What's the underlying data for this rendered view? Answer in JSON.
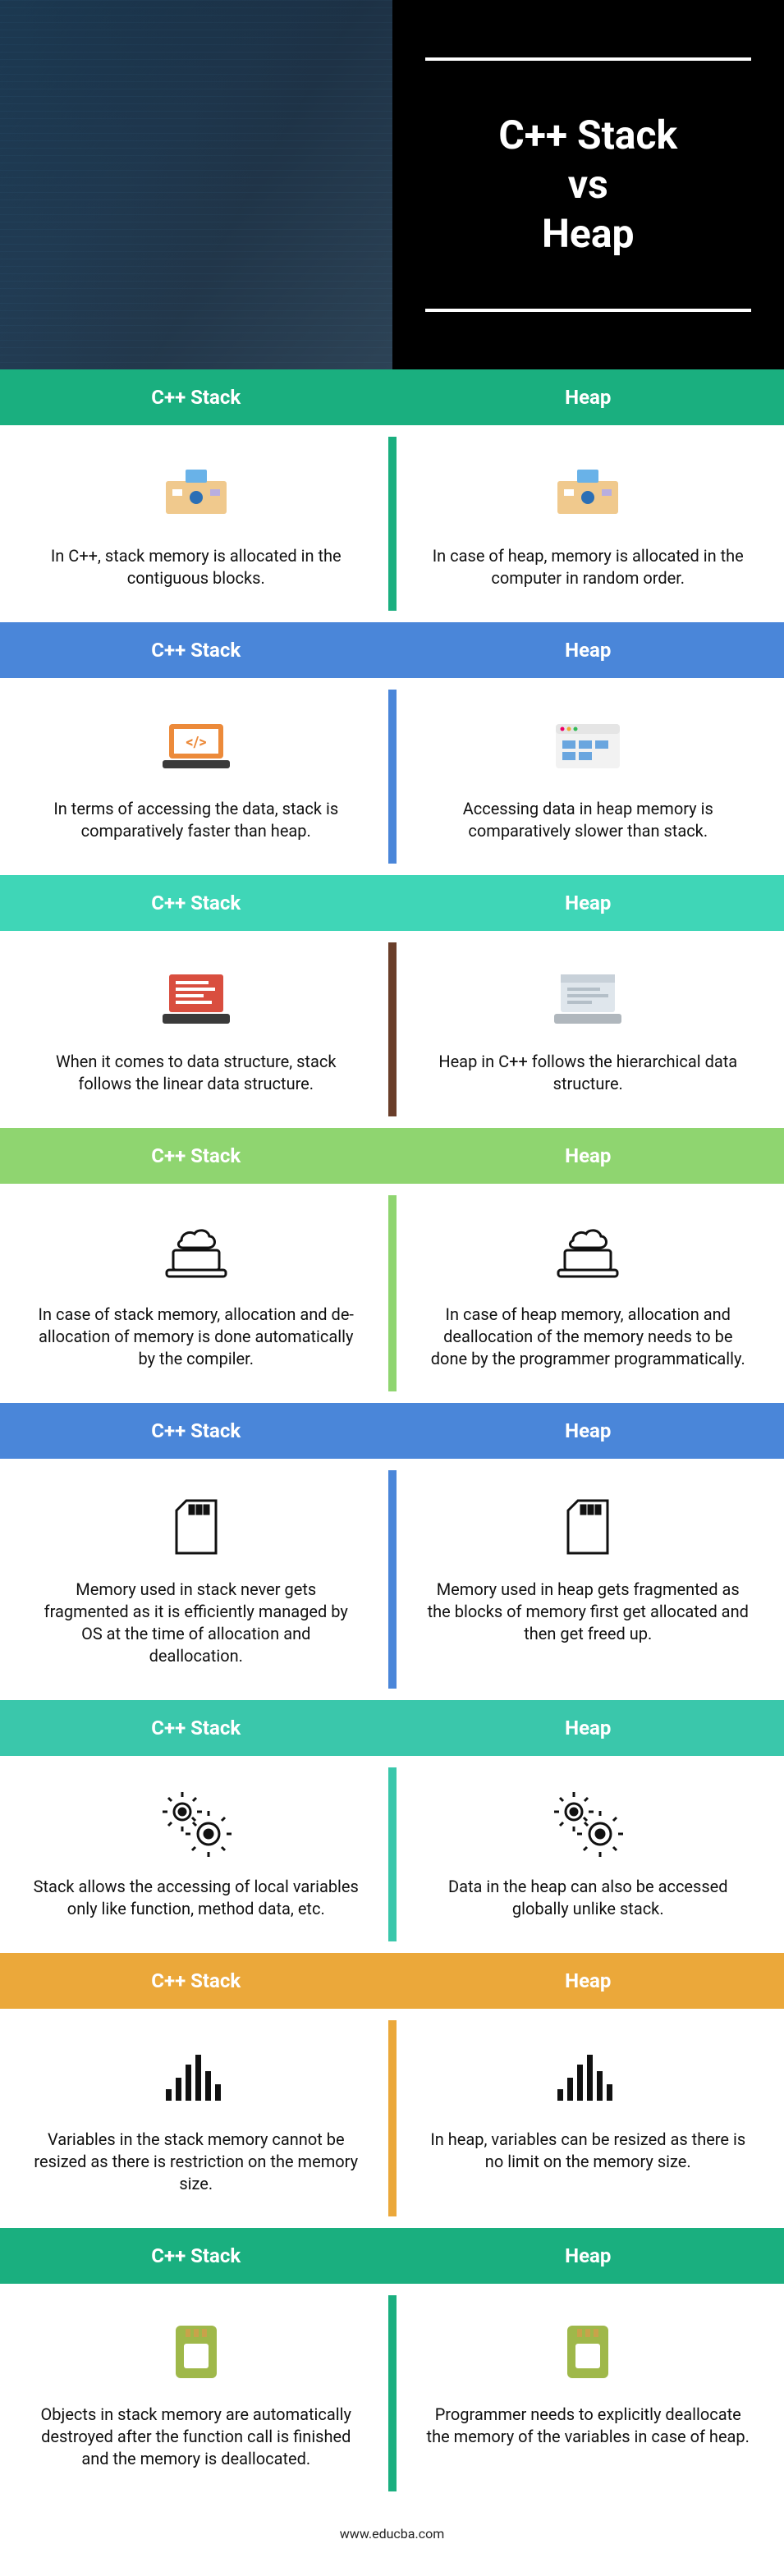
{
  "title_line1": "C++ Stack",
  "title_line2": "vs",
  "title_line3": "Heap",
  "sections": [
    {
      "left_header": "C++ Stack",
      "right_header": "Heap",
      "left_text": "In C++, stack memory is allocated in the contiguous blocks.",
      "right_text": "In case of heap, memory is allocated in the computer in random order.",
      "header_bg": "#1aaf7f",
      "divider_color": "#1aaf7f"
    },
    {
      "left_header": "C++ Stack",
      "right_header": "Heap",
      "left_text": "In terms of accessing the data, stack is comparatively faster than heap.",
      "right_text": "Accessing data in heap memory is comparatively slower than stack.",
      "header_bg": "#4a86d9",
      "divider_color": "#4a86d9"
    },
    {
      "left_header": "C++ Stack",
      "right_header": "Heap",
      "left_text": "When it comes to data structure, stack follows the linear data structure.",
      "right_text": "Heap in C++ follows the hierarchical data structure.",
      "header_bg": "#3fd6b7",
      "divider_color": "#6a3e2a"
    },
    {
      "left_header": "C++ Stack",
      "right_header": "Heap",
      "left_text": "In case of stack memory, allocation and de- allocation of memory is done automatically by the compiler.",
      "right_text": "In case of heap memory, allocation and deallocation of the memory needs to be done by the programmer programmatically.",
      "header_bg": "#8fd570",
      "divider_color": "#8fd570"
    },
    {
      "left_header": "C++ Stack",
      "right_header": "Heap",
      "left_text": "Memory used in stack never gets fragmented as it is efficiently managed by OS at the time of allocation and deallocation.",
      "right_text": "Memory used in heap gets fragmented as the blocks of memory first get allocated and then get freed up.",
      "header_bg": "#4a86d9",
      "divider_color": "#4a86d9"
    },
    {
      "left_header": "C++ Stack",
      "right_header": "Heap",
      "left_text": "Stack allows the accessing of local variables only like function, method data, etc.",
      "right_text": "Data in the heap can also be accessed globally unlike stack.",
      "header_bg": "#3ac7ab",
      "divider_color": "#3ac7ab"
    },
    {
      "left_header": "C++ Stack",
      "right_header": "Heap",
      "left_text": "Variables in the stack memory cannot be resized as there is restriction on the memory size.",
      "right_text": "In heap, variables can be resized as there is no limit on the memory size.",
      "header_bg": "#eba83a",
      "divider_color": "#eba83a"
    },
    {
      "left_header": "C++ Stack",
      "right_header": "Heap",
      "left_text": "Objects in stack memory are automatically destroyed after the function call is finished and the memory is deallocated.",
      "right_text": "Programmer needs to explicitly deallocate the memory of the variables in case of heap.",
      "header_bg": "#1aaf7f",
      "divider_color": "#1aaf7f"
    }
  ],
  "footer": "www.educba.com"
}
